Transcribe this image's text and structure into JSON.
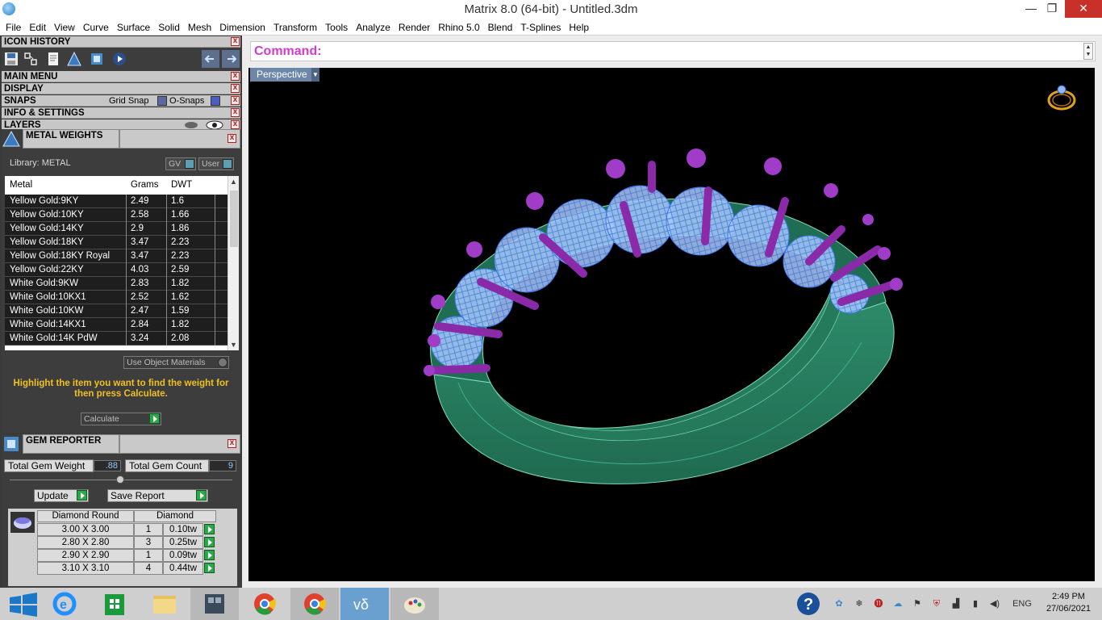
{
  "window": {
    "title": "Matrix 8.0 (64-bit) - Untitled.3dm",
    "minimize": "—",
    "restore": "❐",
    "close": "✕"
  },
  "menubar": [
    "File",
    "Edit",
    "View",
    "Curve",
    "Surface",
    "Solid",
    "Mesh",
    "Dimension",
    "Transform",
    "Tools",
    "Analyze",
    "Render",
    "Rhino 5.0",
    "Blend",
    "T-Splines",
    "Help"
  ],
  "panels": {
    "icon_history": "ICON HISTORY",
    "main_menu": "MAIN MENU",
    "display": "DISPLAY",
    "snaps": {
      "label": "SNAPS",
      "grid_snap": "Grid Snap",
      "o_snaps": "O-Snaps"
    },
    "info_settings": "INFO & SETTINGS",
    "layers": "LAYERS"
  },
  "metal_weights": {
    "title": "METAL WEIGHTS",
    "library": "Library: METAL",
    "gv_label": "GV",
    "user_label": "User",
    "columns": [
      "Metal",
      "Grams",
      "DWT"
    ],
    "rows": [
      [
        "Yellow Gold:9KY",
        "2.49",
        "1.6"
      ],
      [
        "Yellow Gold:10KY",
        "2.58",
        "1.66"
      ],
      [
        "Yellow Gold:14KY",
        "2.9",
        "1.86"
      ],
      [
        "Yellow Gold:18KY",
        "3.47",
        "2.23"
      ],
      [
        "Yellow Gold:18KY Royal",
        "3.47",
        "2.23"
      ],
      [
        "Yellow Gold:22KY",
        "4.03",
        "2.59"
      ],
      [
        "White Gold:9KW",
        "2.83",
        "1.82"
      ],
      [
        "White Gold:10KX1",
        "2.52",
        "1.62"
      ],
      [
        "White Gold:10KW",
        "2.47",
        "1.59"
      ],
      [
        "White Gold:14KX1",
        "2.84",
        "1.82"
      ],
      [
        "White Gold:14K PdW",
        "3.24",
        "2.08"
      ]
    ],
    "use_object_materials": "Use Object Materials",
    "hint": "Highlight the item you want to find the weight for then press Calculate.",
    "calculate": "Calculate"
  },
  "gem_reporter": {
    "title": "GEM REPORTER",
    "total_weight_label": "Total Gem Weight",
    "total_weight": ".88",
    "total_count_label": "Total Gem Count",
    "total_count": "9",
    "update": "Update",
    "save_report": "Save Report",
    "columns": [
      "Diamond Round",
      "Diamond"
    ],
    "rows": [
      [
        "3.00 X 3.00",
        "1",
        "0.10tw"
      ],
      [
        "2.80 X 2.80",
        "3",
        "0.25tw"
      ],
      [
        "2.90 X 2.90",
        "1",
        "0.09tw"
      ],
      [
        "3.10 X 3.10",
        "4",
        "0.44tw"
      ]
    ]
  },
  "command": {
    "label": "Command:"
  },
  "viewport": {
    "name": "Perspective"
  },
  "taskbar": {
    "language": "ENG",
    "time": "2:49 PM",
    "date": "27/06/2021"
  }
}
